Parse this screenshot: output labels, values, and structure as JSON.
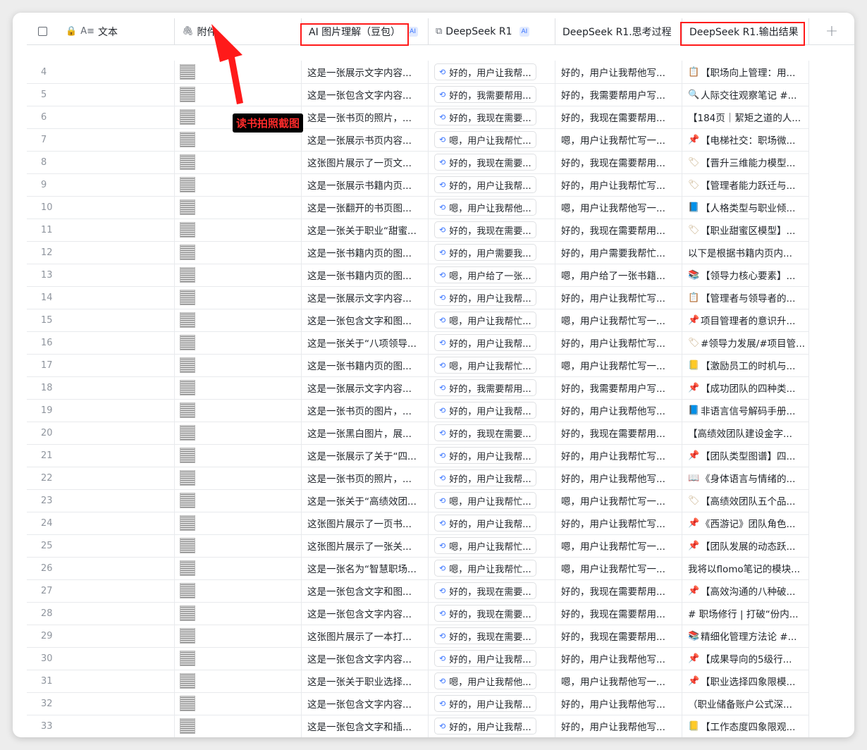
{
  "header": {
    "col_text": "文本",
    "col_attach": "附件",
    "col_ai_image": "AI 图片理解（豆包）",
    "col_ds": "DeepSeek R1",
    "col_ds_think": "DeepSeek R1.思考过程",
    "col_ds_out": "DeepSeek R1.输出结果",
    "ai_badge": "AI",
    "add_column": "+"
  },
  "annotation": {
    "label": "读书拍照截图"
  },
  "rows": [
    {
      "n": "4",
      "ai": "这是一张展示文字内容...",
      "ds": "好的，用户让我帮...",
      "think": "好的，用户让我帮他写...",
      "out": "【职场向上管理：用...",
      "emoji": "📋",
      "ec": "clip"
    },
    {
      "n": "5",
      "ai": "这是一张包含文字内容...",
      "ds": "好的，我需要帮用...",
      "think": "好的，我需要帮用户写...",
      "out": "人际交往观察笔记 #...",
      "emoji": "🔍",
      "ec": "mag"
    },
    {
      "n": "6",
      "ai": "这是一张书页的照片，...",
      "ds": "好的，我现在需要...",
      "think": "好的，我现在需要帮用...",
      "out": "【184页｜絜矩之道的人...",
      "emoji": "",
      "ec": ""
    },
    {
      "n": "7",
      "ai": "这是一张展示书页内容...",
      "ds": "嗯，用户让我帮忙...",
      "think": "嗯，用户让我帮忙写一...",
      "out": "【电梯社交：职场微...",
      "emoji": "📌",
      "ec": "pin"
    },
    {
      "n": "8",
      "ai": "这张图片展示了一页文...",
      "ds": "好的，我现在需要...",
      "think": "好的，我现在需要帮用...",
      "out": "【晋升三维能力模型...",
      "emoji": "🏷",
      "ec": "tag"
    },
    {
      "n": "9",
      "ai": "这是一张展示书籍内页...",
      "ds": "好的，用户让我帮...",
      "think": "好的，用户让我帮忙写...",
      "out": "【管理者能力跃迁与...",
      "emoji": "🏷",
      "ec": "tag"
    },
    {
      "n": "10",
      "ai": "这是一张翻开的书页图...",
      "ds": "嗯，用户让我帮他...",
      "think": "嗯，用户让我帮他写一...",
      "out": "【人格类型与职业倾...",
      "emoji": "📘",
      "ec": "blue"
    },
    {
      "n": "11",
      "ai": "这是一张关于职业“甜蜜...",
      "ds": "好的，我现在需要...",
      "think": "好的，我现在需要帮用...",
      "out": "【职业甜蜜区模型】...",
      "emoji": "🏷",
      "ec": "tag"
    },
    {
      "n": "12",
      "ai": "这是一张书籍内页的图...",
      "ds": "好的，用户需要我...",
      "think": "好的，用户需要我帮忙...",
      "out": "以下是根据书籍内页内...",
      "emoji": "",
      "ec": ""
    },
    {
      "n": "13",
      "ai": "这是一张书籍内页的图...",
      "ds": "嗯，用户给了一张...",
      "think": "嗯，用户给了一张书籍...",
      "out": "【领导力核心要素】...",
      "emoji": "📚",
      "ec": "book"
    },
    {
      "n": "14",
      "ai": "这是一张展示文字内容...",
      "ds": "好的，用户让我帮...",
      "think": "好的，用户让我帮忙写...",
      "out": "【管理者与领导者的...",
      "emoji": "📋",
      "ec": "clip"
    },
    {
      "n": "15",
      "ai": "这是一张包含文字和图...",
      "ds": "嗯，用户让我帮忙...",
      "think": "嗯，用户让我帮忙写一...",
      "out": "项目管理者的意识升...",
      "emoji": "📌",
      "ec": "pin"
    },
    {
      "n": "16",
      "ai": "这是一张关于“八项领导...",
      "ds": "好的，用户让我帮...",
      "think": "好的，用户让我帮忙写...",
      "out": "#领导力发展/#项目管...",
      "emoji": "🏷",
      "ec": "tag"
    },
    {
      "n": "17",
      "ai": "这是一张书籍内页的图...",
      "ds": "嗯，用户让我帮忙...",
      "think": "嗯，用户让我帮忙写一...",
      "out": "【激励员工的时机与...",
      "emoji": "📒",
      "ec": "yel"
    },
    {
      "n": "18",
      "ai": "这是一张展示文字内容...",
      "ds": "好的，我需要帮用...",
      "think": "好的，我需要帮用户写...",
      "out": "【成功团队的四种类...",
      "emoji": "📌",
      "ec": "pin"
    },
    {
      "n": "19",
      "ai": "这是一张书页的图片，...",
      "ds": "好的，用户让我帮...",
      "think": "好的，用户让我帮他写...",
      "out": "非语言信号解码手册...",
      "emoji": "📘",
      "ec": "blue"
    },
    {
      "n": "20",
      "ai": "这是一张黑白图片，展...",
      "ds": "好的，我现在需要...",
      "think": "好的，我现在需要帮用...",
      "out": "【高绩效团队建设金字...",
      "emoji": "",
      "ec": ""
    },
    {
      "n": "21",
      "ai": "这是一张展示了关于“四...",
      "ds": "好的，用户让我帮...",
      "think": "好的，用户让我帮忙写...",
      "out": "【团队类型图谱】四...",
      "emoji": "📌",
      "ec": "pin"
    },
    {
      "n": "22",
      "ai": "这是一张书页的照片，...",
      "ds": "好的，用户让我帮...",
      "think": "好的，用户让我帮他写...",
      "out": "《身体语言与情绪的...",
      "emoji": "📖",
      "ec": "open"
    },
    {
      "n": "23",
      "ai": "这是一张关于“高绩效团...",
      "ds": "嗯，用户让我帮忙...",
      "think": "嗯，用户让我帮忙写一...",
      "out": "【高绩效团队五个品...",
      "emoji": "🏷",
      "ec": "tag"
    },
    {
      "n": "24",
      "ai": "这张图片展示了一页书...",
      "ds": "好的，用户让我帮...",
      "think": "好的，用户让我帮忙写...",
      "out": "《西游记》团队角色...",
      "emoji": "📌",
      "ec": "pin"
    },
    {
      "n": "25",
      "ai": "这张图片展示了一张关...",
      "ds": "嗯，用户让我帮忙...",
      "think": "嗯，用户让我帮忙写一...",
      "out": "【团队发展的动态跃...",
      "emoji": "📌",
      "ec": "pin"
    },
    {
      "n": "26",
      "ai": "这是一张名为“智慧职场...",
      "ds": "嗯，用户让我帮忙...",
      "think": "嗯，用户让我帮忙写一...",
      "out": "我将以flomo笔记的模块...",
      "emoji": "",
      "ec": ""
    },
    {
      "n": "27",
      "ai": "这是一张包含文字和图...",
      "ds": "好的，我现在需要...",
      "think": "好的，我现在需要帮用...",
      "out": "【高效沟通的八种破...",
      "emoji": "📌",
      "ec": "pin"
    },
    {
      "n": "28",
      "ai": "这是一张包含文字内容...",
      "ds": "好的，我现在需要...",
      "think": "好的，我现在需要帮用...",
      "out": "# 职场修行 | 打破“份内...",
      "emoji": "",
      "ec": ""
    },
    {
      "n": "29",
      "ai": "这张图片展示了一本打...",
      "ds": "好的，我现在需要...",
      "think": "好的，我现在需要帮用...",
      "out": "精细化管理方法论 #...",
      "emoji": "📚",
      "ec": "book"
    },
    {
      "n": "30",
      "ai": "这是一张包含文字内容...",
      "ds": "好的，用户让我帮...",
      "think": "好的，用户让我帮他写...",
      "out": "【成果导向的5级行...",
      "emoji": "📌",
      "ec": "pin"
    },
    {
      "n": "31",
      "ai": "这是一张关于职业选择...",
      "ds": "嗯，用户让我帮他...",
      "think": "嗯，用户让我帮他写一...",
      "out": "【职业选择四象限模...",
      "emoji": "📌",
      "ec": "pin"
    },
    {
      "n": "32",
      "ai": "这是一张包含文字内容...",
      "ds": "好的，用户让我帮...",
      "think": "好的，用户让我帮他写...",
      "out": "（职业储备账户公式深...",
      "emoji": "",
      "ec": ""
    },
    {
      "n": "33",
      "ai": "这是一张包含文字和插...",
      "ds": "好的，用户让我帮...",
      "think": "好的，用户让我帮他写...",
      "out": "【工作态度四象限观...",
      "emoji": "📒",
      "ec": "yel"
    }
  ],
  "footer": {
    "add_row": "+"
  }
}
